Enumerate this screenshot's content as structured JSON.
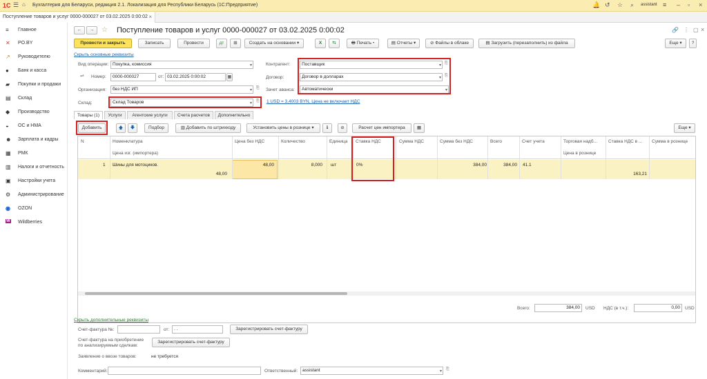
{
  "titlebar": {
    "logo": "1С",
    "title": "Бухгалтерия для Беларуси, редакция 2.1. Локализация для Республики Беларусь (1С:Предприятие)",
    "user": "assistant"
  },
  "tabbar": {
    "doc_tab": "Поступление товаров и услуг 0000-000027 от 03.02.2025 0:00:02"
  },
  "sidebar": {
    "items": [
      {
        "label": "Главное",
        "icon": "menu-icon"
      },
      {
        "label": "PO.BY",
        "icon": "link-icon"
      },
      {
        "label": "Руководителю",
        "icon": "chart-icon"
      },
      {
        "label": "Банк и касса",
        "icon": "bank-icon"
      },
      {
        "label": "Покупки и продажи",
        "icon": "cart-icon"
      },
      {
        "label": "Склад",
        "icon": "warehouse-icon"
      },
      {
        "label": "Производство",
        "icon": "factory-icon"
      },
      {
        "label": "ОС и НМА",
        "icon": "car-icon"
      },
      {
        "label": "Зарплата и кадры",
        "icon": "people-icon"
      },
      {
        "label": "РМК",
        "icon": "register-icon"
      },
      {
        "label": "Налоги и отчетность",
        "icon": "tax-icon"
      },
      {
        "label": "Настройки учета",
        "icon": "settings-icon"
      },
      {
        "label": "Администрирование",
        "icon": "gear-icon"
      },
      {
        "label": "OZON",
        "icon": "ozon-icon"
      },
      {
        "label": "Wildberries",
        "icon": "wildberries-icon"
      }
    ]
  },
  "doc": {
    "title": "Поступление товаров и услуг 0000-000027 от 03.02.2025 0:00:02",
    "toolbar": {
      "post_close": "Провести и закрыть",
      "save": "Записать",
      "post": "Провести",
      "create_basis": "Создать на основании",
      "print": "Печать",
      "reports": "Отчеты",
      "cloud": "Файлы в облаке",
      "load": "Загрузить (перезаполнить) из файла",
      "more": "Еще"
    },
    "hide_link": "Скрыть основные реквизиты",
    "fields": {
      "op_label": "Вид операции:",
      "op_value": "Покупка, комиссия",
      "num_label": "Номер:",
      "num_value": "0000-000027",
      "date_label": "от:",
      "date_value": "03.02.2025  0:00:02",
      "org_label": "Организация:",
      "org_value": "без НДС ИП",
      "wh_label": "Склад:",
      "wh_value": "Склад Товаров",
      "cp_label": "Контрагент:",
      "cp_value": "Поставщик",
      "contract_label": "Договор:",
      "contract_value": "Договор в долларах",
      "advance_label": "Зачет аванса:",
      "advance_value": "Автоматически",
      "rate_link": "1 USD = 3,4003 BYN, Цена не включает НДС"
    },
    "tabs": [
      "Товары (1)",
      "Услуги",
      "Агентские услуги",
      "Счета расчетов",
      "Дополнительно"
    ],
    "grid_toolbar": {
      "add": "Добавить",
      "selection": "Подбор",
      "by_barcode": "Добавить по штрихкоду",
      "set_prices": "Установить цены в рознице",
      "import_calc": "Расчет цен импортера",
      "more": "Еще"
    },
    "columns": [
      "N",
      "Номенклатура",
      "Цена изг. (импортера)",
      "Цена без НДС",
      "Количество",
      "Единица",
      "Ставка НДС",
      "Сумма НДС",
      "Сумма без НДС",
      "Всего",
      "Счет учета",
      "Торговая надб...",
      "Цена в рознице",
      "Ставка НДС в ...",
      "Сумма в рознице"
    ],
    "row": {
      "n": "1",
      "name": "Шины для мотоциков.",
      "mfr_price": "48,00",
      "price": "48,00",
      "qty": "8,000",
      "unit": "шт",
      "vat_rate": "0%",
      "sum_no_vat": "384,00",
      "total": "384,00",
      "account": "41.1",
      "retail_sum": "163,21"
    },
    "totals": {
      "total_label": "Всего:",
      "total_value": "384,00",
      "currency": "USD",
      "vat_label": "НДС (в т.ч.):",
      "vat_value": "0,00",
      "vat_currency": "USD"
    },
    "footer": {
      "hide_extra": "Скрыть дополнительные реквизиты",
      "invoice_label": "Счет-фактура №:",
      "invoice_from": "от:",
      "invoice_date": ". .",
      "reg_invoice": "Зарегистрировать счет-фактуру",
      "invoice_anon_label1": "Счет-фактура на приобретение",
      "invoice_anon_label2": "по анализируемым сделкам:",
      "reg_invoice2": "Зарегистрировать счет-фактуру",
      "import_label": "Заявление о ввозе товаров:",
      "import_value": "не требуется",
      "comment_label": "Комментарий:",
      "resp_label": "Ответственный:",
      "resp_value": "assistant"
    }
  }
}
